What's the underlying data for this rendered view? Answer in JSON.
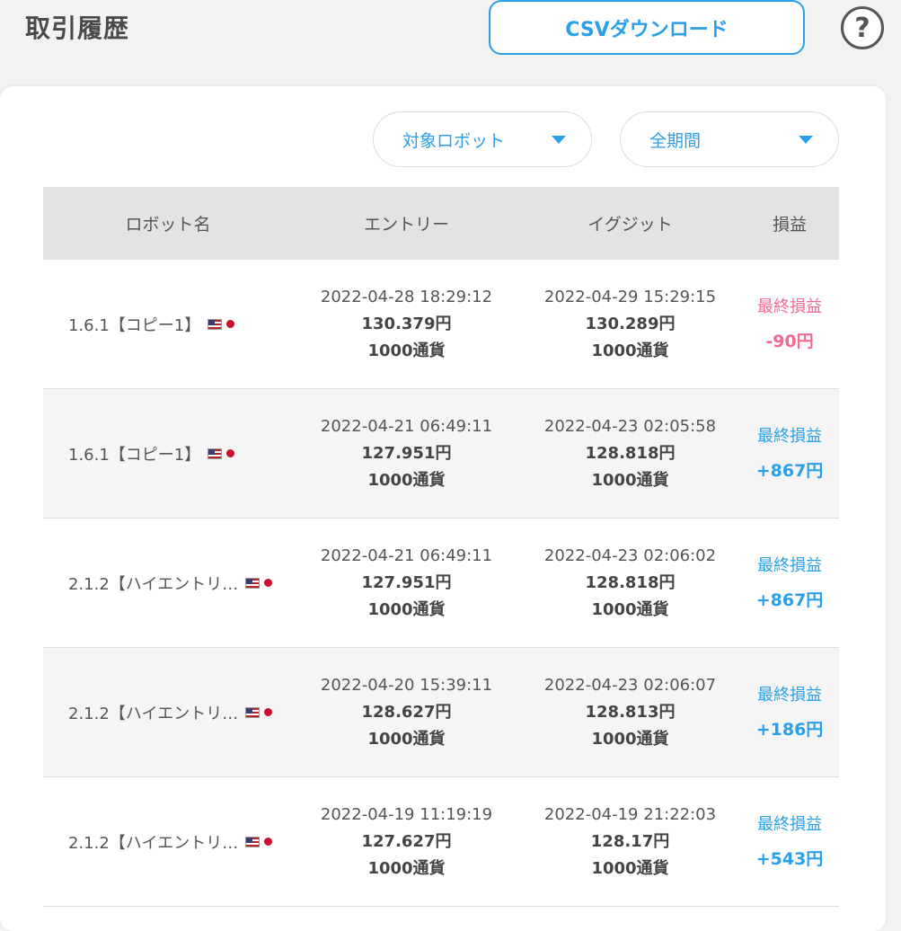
{
  "header": {
    "title": "取引履歴",
    "csv_button": "CSVダウンロード",
    "help": "?"
  },
  "filters": {
    "robot": "対象ロボット",
    "period": "全期間"
  },
  "table": {
    "columns": [
      "ロボット名",
      "エントリー",
      "イグジット",
      "損益"
    ],
    "rows": [
      {
        "robot": "1.6.1【コピー1】",
        "entry_time": "2022-04-28 18:29:12",
        "entry_price": "130.379円",
        "entry_qty": "1000通貨",
        "exit_time": "2022-04-29 15:29:15",
        "exit_price": "130.289円",
        "exit_qty": "1000通貨",
        "pl_label": "最終損益",
        "pl_value": "-90円",
        "pl_color": "#f06b8f"
      },
      {
        "robot": "1.6.1【コピー1】",
        "entry_time": "2022-04-21 06:49:11",
        "entry_price": "127.951円",
        "entry_qty": "1000通貨",
        "exit_time": "2022-04-23 02:05:58",
        "exit_price": "128.818円",
        "exit_qty": "1000通貨",
        "pl_label": "最終損益",
        "pl_value": "+867円",
        "pl_color": "#2b9fe8"
      },
      {
        "robot": "2.1.2【ハイエントリ…",
        "entry_time": "2022-04-21 06:49:11",
        "entry_price": "127.951円",
        "entry_qty": "1000通貨",
        "exit_time": "2022-04-23 02:06:02",
        "exit_price": "128.818円",
        "exit_qty": "1000通貨",
        "pl_label": "最終損益",
        "pl_value": "+867円",
        "pl_color": "#2b9fe8"
      },
      {
        "robot": "2.1.2【ハイエントリ…",
        "entry_time": "2022-04-20 15:39:11",
        "entry_price": "128.627円",
        "entry_qty": "1000通貨",
        "exit_time": "2022-04-23 02:06:07",
        "exit_price": "128.813円",
        "exit_qty": "1000通貨",
        "pl_label": "最終損益",
        "pl_value": "+186円",
        "pl_color": "#2b9fe8"
      },
      {
        "robot": "2.1.2【ハイエントリ…",
        "entry_time": "2022-04-19 11:19:19",
        "entry_price": "127.627円",
        "entry_qty": "1000通貨",
        "exit_time": "2022-04-19 21:22:03",
        "exit_price": "128.17円",
        "exit_qty": "1000通貨",
        "pl_label": "最終損益",
        "pl_value": "+543円",
        "pl_color": "#2b9fe8"
      }
    ]
  },
  "icons": {
    "help": "question-circle-icon",
    "caret": "caret-down-icon",
    "flag_us": "us-flag-icon",
    "flag_jp": "jp-flag-icon"
  },
  "colors": {
    "accent": "#2b9fe8",
    "loss": "#f06b8f"
  }
}
